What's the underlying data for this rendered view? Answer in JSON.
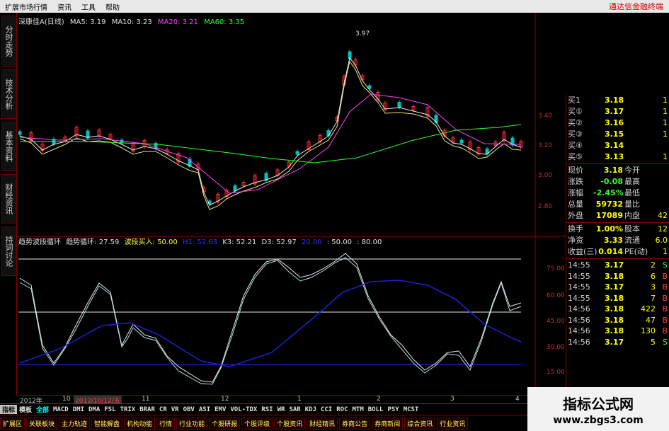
{
  "menu": {
    "items": [
      "扩展市场行情",
      "资讯",
      "工具",
      "帮助"
    ],
    "ad": "通达信金融终端"
  },
  "left_tabs": [
    "分时走势",
    "技术分析",
    "基本资料",
    "财经资讯",
    "持词讨论"
  ],
  "header": {
    "name": "深康佳A",
    "period": "(日线)",
    "ma5": "MA5: 3.19",
    "ma10": "MA10: 3.23",
    "ma20": "MA20: 3.21",
    "ma60": "MA60: 3.35",
    "peak": "3.97"
  },
  "price_axis": [
    "3.40",
    "3.20",
    "3.00",
    "2.80"
  ],
  "indicator": {
    "name": "趋势波段循环",
    "trend": "趋势循环: 27.59",
    "band": "波段买入: 50.00",
    "h1": "H1: 52.63",
    "k3": "K3: 52.21",
    "d3": "D3: 52.97",
    "ref": "20.00",
    "l50": ": 50.00",
    "l80": ": 80.00"
  },
  "ind_axis": [
    "75.00",
    "60.00",
    "45.00",
    "30.00",
    "15.00"
  ],
  "quotes": {
    "bids": [
      {
        "label": "买1",
        "price": "3.18",
        "vol": "1"
      },
      {
        "label": "买①",
        "price": "3.17",
        "vol": "1"
      },
      {
        "label": "买②",
        "price": "3.16",
        "vol": "1"
      },
      {
        "label": "买③",
        "price": "3.15",
        "vol": "1"
      },
      {
        "label": "买④",
        "price": "3.14",
        "vol": ""
      },
      {
        "label": "买⑤",
        "price": "3.13",
        "vol": "1"
      }
    ],
    "stats": [
      {
        "l1": "现价",
        "v1": "3.18",
        "l2": "今开",
        "v2": ""
      },
      {
        "l1": "涨跌",
        "v1": "-0.08",
        "l2": "最高",
        "v2": ""
      },
      {
        "l1": "涨幅",
        "v1": "-2.45%",
        "l2": "最低",
        "v2": ""
      },
      {
        "l1": "总量",
        "v1": "59732",
        "l2": "量比",
        "v2": ""
      },
      {
        "l1": "外盘",
        "v1": "17089",
        "l2": "内盘",
        "v2": "42"
      }
    ],
    "stats2": [
      {
        "l1": "换手",
        "v1": "1.00%",
        "l2": "股本",
        "v2": "12"
      },
      {
        "l1": "净资",
        "v1": "3.33",
        "l2": "流通",
        "v2": "6.0"
      },
      {
        "l1": "收益(三)",
        "v1": "0.014",
        "l2": "PE(动)",
        "v2": "1"
      }
    ],
    "ticks": [
      {
        "t": "14:55",
        "p": "3.17",
        "v": "2",
        "s": "S"
      },
      {
        "t": "14:55",
        "p": "3.18",
        "v": "6",
        "s": "B"
      },
      {
        "t": "14:55",
        "p": "3.17",
        "v": "3",
        "s": "B"
      },
      {
        "t": "14:55",
        "p": "3.18",
        "v": "7",
        "s": "B"
      },
      {
        "t": "14:56",
        "p": "3.18",
        "v": "422",
        "s": "B"
      },
      {
        "t": "14:56",
        "p": "3.18",
        "v": "47",
        "s": "B"
      },
      {
        "t": "14:56",
        "p": "3.18",
        "v": "130",
        "s": "B"
      },
      {
        "t": "14:56",
        "p": "3.17",
        "v": "5",
        "s": "S"
      }
    ]
  },
  "datebar": {
    "y": "2012年",
    "m10": "10",
    "cur": "2012/10/12/五",
    "m11": "11",
    "m12": "12",
    "m1": "1",
    "m2": "2",
    "m3": "3",
    "m4": "4"
  },
  "indicator_tabs": [
    "指标",
    "模板",
    "全部",
    "MACD",
    "DMI",
    "DMA",
    "FSL",
    "TRIX",
    "BRAR",
    "CR",
    "VR",
    "OBV",
    "ASI",
    "EMV",
    "VOL-TDX",
    "RSI",
    "WR",
    "SAR",
    "KDJ",
    "CCI",
    "ROC",
    "MTM",
    "BOLL",
    "PSY",
    "MCST"
  ],
  "bottom_tabs": [
    "扩展区",
    "关联板块",
    "主力轨迹",
    "智能解盘",
    "机构动能",
    "行情",
    "行业功能",
    "个股研报",
    "个股评级",
    "个股资讯",
    "财经精讯",
    "券商公告",
    "券商新闻",
    "综合资讯",
    "行业资讯"
  ],
  "watermark": {
    "line1": "指标公式网",
    "line2": "www.zbgs3.com"
  }
}
